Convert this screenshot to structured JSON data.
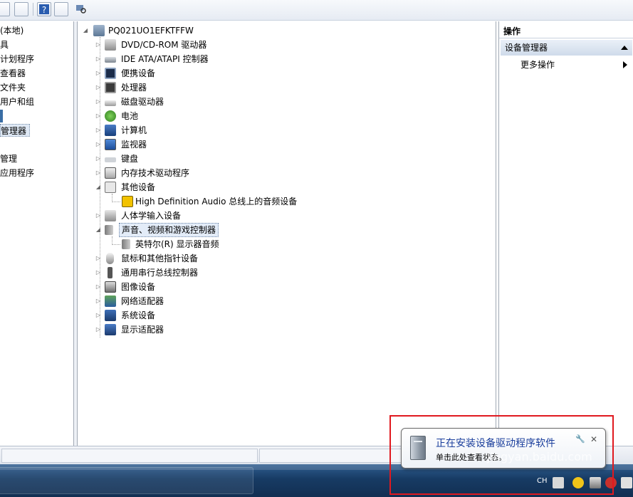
{
  "left_pane": {
    "items": [
      {
        "label": "(本地)",
        "selected": false
      },
      {
        "label": "具",
        "selected": false
      },
      {
        "label": "计划程序",
        "selected": false
      },
      {
        "label": "查看器",
        "selected": false
      },
      {
        "label": "文件夹",
        "selected": false
      },
      {
        "label": "用户和组",
        "selected": false
      },
      {
        "label": "",
        "selected": false
      },
      {
        "label": "管理器",
        "selected": true
      },
      {
        "label": "",
        "selected": false
      },
      {
        "label": "管理",
        "selected": false
      },
      {
        "label": "应用程序",
        "selected": false
      }
    ]
  },
  "tree": {
    "root": "PQ021UO1EFKTFFW",
    "nodes": [
      {
        "label": "DVD/CD-ROM 驱动器",
        "icon": "dvd-drive-icon",
        "expanded": false
      },
      {
        "label": "IDE ATA/ATAPI 控制器",
        "icon": "ide-controller-icon",
        "expanded": false
      },
      {
        "label": "便携设备",
        "icon": "portable-device-icon",
        "expanded": false
      },
      {
        "label": "处理器",
        "icon": "processor-icon",
        "expanded": false
      },
      {
        "label": "磁盘驱动器",
        "icon": "disk-drive-icon",
        "expanded": false
      },
      {
        "label": "电池",
        "icon": "battery-icon",
        "expanded": false
      },
      {
        "label": "计算机",
        "icon": "computer-icon",
        "expanded": false
      },
      {
        "label": "监视器",
        "icon": "monitor-icon",
        "expanded": false
      },
      {
        "label": "键盘",
        "icon": "keyboard-icon",
        "expanded": false
      },
      {
        "label": "内存技术驱动程序",
        "icon": "memory-icon",
        "expanded": false
      },
      {
        "label": "其他设备",
        "icon": "unknown-device-icon",
        "expanded": true
      },
      {
        "label": "High Definition Audio 总线上的音频设备",
        "icon": "warning-device-icon",
        "child": true
      },
      {
        "label": "人体学输入设备",
        "icon": "hid-icon",
        "expanded": false
      },
      {
        "label": "声音、视频和游戏控制器",
        "icon": "speaker-icon",
        "expanded": true,
        "selected": true
      },
      {
        "label": "英特尔(R) 显示器音频",
        "icon": "speaker-icon",
        "child": true
      },
      {
        "label": "鼠标和其他指针设备",
        "icon": "mouse-icon",
        "expanded": false
      },
      {
        "label": "通用串行总线控制器",
        "icon": "usb-icon",
        "expanded": false
      },
      {
        "label": "图像设备",
        "icon": "camera-icon",
        "expanded": false
      },
      {
        "label": "网络适配器",
        "icon": "network-adapter-icon",
        "expanded": false
      },
      {
        "label": "系统设备",
        "icon": "system-device-icon",
        "expanded": false
      },
      {
        "label": "显示适配器",
        "icon": "display-adapter-icon",
        "expanded": false
      }
    ]
  },
  "actions": {
    "header": "操作",
    "section": "设备管理器",
    "more": "更多操作"
  },
  "balloon": {
    "title": "正在安装设备驱动程序软件",
    "subtitle": "单击此处查看状态。",
    "close": "✕"
  },
  "tray": {
    "ime": "CH"
  },
  "watermark": "jingyan.baidu.com",
  "colors": {
    "highlight": "#e0191f",
    "balloon_title": "#1a3e9c",
    "taskbar": "#173b64"
  }
}
